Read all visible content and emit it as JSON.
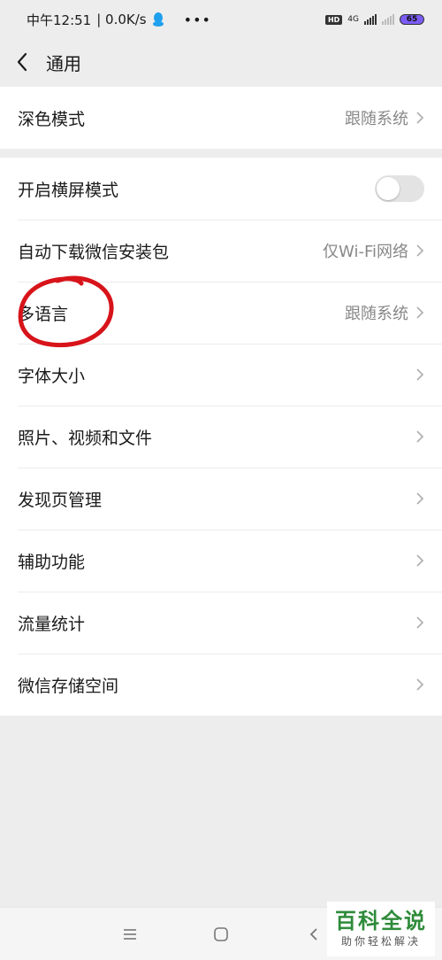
{
  "status_bar": {
    "time": "中午12:51",
    "speed": "| 0.0K/s",
    "hd": "HD",
    "network": "4G",
    "battery": "65",
    "more": "•••"
  },
  "header": {
    "title": "通用"
  },
  "settings": {
    "dark_mode": {
      "label": "深色模式",
      "value": "跟随系统"
    },
    "landscape": {
      "label": "开启横屏模式",
      "enabled": false
    },
    "auto_download": {
      "label": "自动下载微信安装包",
      "value": "仅Wi-Fi网络"
    },
    "language": {
      "label": "多语言",
      "value": "跟随系统"
    },
    "font_size": {
      "label": "字体大小"
    },
    "media": {
      "label": "照片、视频和文件"
    },
    "discover": {
      "label": "发现页管理"
    },
    "accessibility": {
      "label": "辅助功能"
    },
    "traffic": {
      "label": "流量统计"
    },
    "storage": {
      "label": "微信存储空间"
    }
  },
  "watermark": {
    "title": "百科全说",
    "subtitle": "助你轻松解决"
  },
  "colors": {
    "background": "#ededed",
    "annotation": "#d7141a",
    "watermark_green": "#2e8b3a",
    "battery": "#7b5cf5"
  }
}
